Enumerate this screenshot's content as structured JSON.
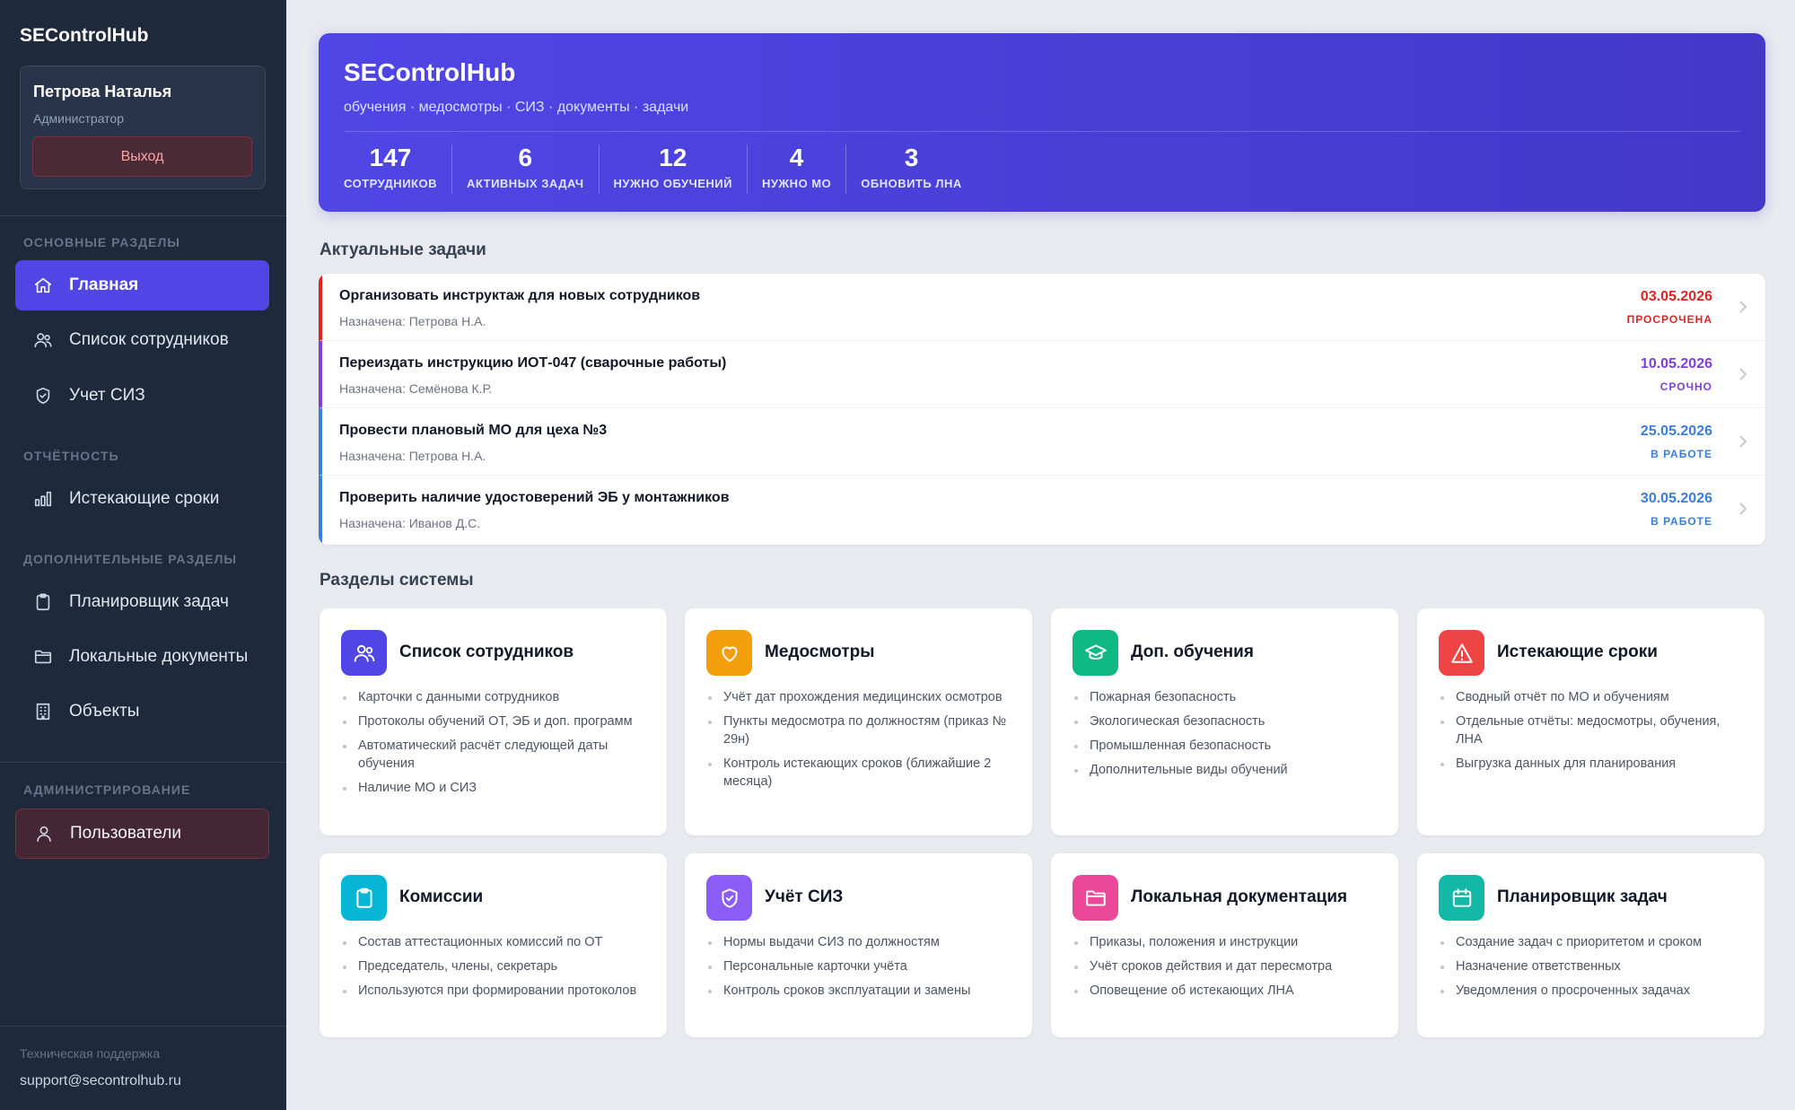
{
  "sidebar": {
    "brand": "SEControlHub",
    "user": {
      "name": "Петрова Наталья",
      "role": "Администратор",
      "logout_label": "Выход"
    },
    "sections": {
      "main": "ОСНОВНЫЕ РАЗДЕЛЫ",
      "reports": "ОТЧЁТНОСТЬ",
      "extra": "ДОПОЛНИТЕЛЬНЫЕ РАЗДЕЛЫ",
      "admin": "АДМИНИСТРИРОВАНИЕ"
    },
    "items": [
      {
        "label": "Главная",
        "icon": "home-icon"
      },
      {
        "label": "Список сотрудников",
        "icon": "users-icon"
      },
      {
        "label": "Учет СИЗ",
        "icon": "shield-icon"
      },
      {
        "label": "Истекающие сроки",
        "icon": "bar-chart-icon"
      },
      {
        "label": "Планировщик задач",
        "icon": "clipboard-icon"
      },
      {
        "label": "Локальные документы",
        "icon": "folder-icon"
      },
      {
        "label": "Объекты",
        "icon": "building-icon"
      },
      {
        "label": "Пользователи",
        "icon": "user-icon"
      }
    ],
    "support_label": "Техническая поддержка",
    "support_email": "support@secontrolhub.ru"
  },
  "hero": {
    "title": "SEControlHub",
    "subtitle": "обучения · медосмотры · СИЗ · документы · задачи",
    "stats": [
      {
        "value": "147",
        "label": "СОТРУДНИКОВ"
      },
      {
        "value": "6",
        "label": "АКТИВНЫХ ЗАДАЧ"
      },
      {
        "value": "12",
        "label": "НУЖНО ОБУЧЕНИЙ"
      },
      {
        "value": "4",
        "label": "НУЖНО МО"
      },
      {
        "value": "3",
        "label": "ОБНОВИТЬ ЛНА"
      }
    ]
  },
  "tasks_section": {
    "title": "Актуальные задачи",
    "tasks": [
      {
        "title": "Организовать инструктаж для новых сотрудников",
        "assigned": "Назначена: Петрова Н.А.",
        "date": "03.05.2026",
        "status": "ПРОСРОЧЕНА",
        "color": "#dc2626"
      },
      {
        "title": "Переиздать инструкцию ИОТ-047 (сварочные работы)",
        "assigned": "Назначена: Семёнова К.Р.",
        "date": "10.05.2026",
        "status": "СРОЧНО",
        "color": "#7e3fd6"
      },
      {
        "title": "Провести плановый МО для цеха №3",
        "assigned": "Назначена: Петрова Н.А.",
        "date": "25.05.2026",
        "status": "В РАБОТЕ",
        "color": "#3b7dd8"
      },
      {
        "title": "Проверить наличие удостоверений ЭБ у монтажников",
        "assigned": "Назначена: Иванов Д.С.",
        "date": "30.05.2026",
        "status": "В РАБОТЕ",
        "color": "#3b7dd8"
      }
    ]
  },
  "modules_section": {
    "title": "Разделы системы",
    "cards": [
      {
        "title": "Список сотрудников",
        "icon": "users-icon",
        "color": "#4f46e5",
        "items": [
          "Карточки с данными сотрудников",
          "Протоколы обучений ОТ, ЭБ и доп. программ",
          "Автоматический расчёт следующей даты обучения",
          "Наличие МО и СИЗ"
        ]
      },
      {
        "title": "Медосмотры",
        "icon": "heart-icon",
        "color": "#f59e0b",
        "items": [
          "Учёт дат прохождения медицинских осмотров",
          "Пункты медосмотра по должностям (приказ № 29н)",
          "Контроль истекающих сроков (ближайшие 2 месяца)"
        ]
      },
      {
        "title": "Доп. обучения",
        "icon": "graduation-cap-icon",
        "color": "#10b981",
        "items": [
          "Пожарная безопасность",
          "Экологическая безопасность",
          "Промышленная безопасность",
          "Дополнительные виды обучений"
        ]
      },
      {
        "title": "Истекающие сроки",
        "icon": "warning-icon",
        "color": "#ef4444",
        "items": [
          "Сводный отчёт по МО и обучениям",
          "Отдельные отчёты: медосмотры, обучения, ЛНА",
          "Выгрузка данных для планирования"
        ]
      },
      {
        "title": "Комиссии",
        "icon": "clipboard-icon",
        "color": "#06b6d4",
        "items": [
          "Состав аттестационных комиссий по ОТ",
          "Председатель, члены, секретарь",
          "Используются при формировании протоколов"
        ]
      },
      {
        "title": "Учёт СИЗ",
        "icon": "shield-check-icon",
        "color": "#8b5cf6",
        "items": [
          "Нормы выдачи СИЗ по должностям",
          "Персональные карточки учёта",
          "Контроль сроков эксплуатации и замены"
        ]
      },
      {
        "title": "Локальная документация",
        "icon": "folder-icon",
        "color": "#ec4899",
        "items": [
          "Приказы, положения и инструкции",
          "Учёт сроков действия и дат пересмотра",
          "Оповещение об истекающих ЛНА"
        ]
      },
      {
        "title": "Планировщик задач",
        "icon": "calendar-icon",
        "color": "#14b8a6",
        "items": [
          "Создание задач с приоритетом и сроком",
          "Назначение ответственных",
          "Уведомления о просроченных задачах"
        ]
      }
    ]
  }
}
